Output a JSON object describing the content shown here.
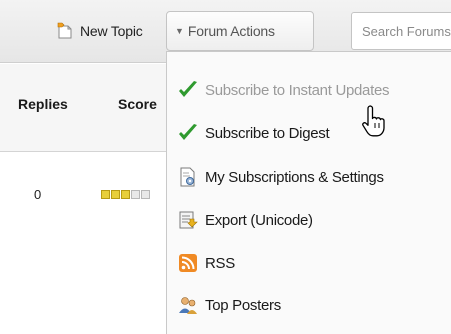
{
  "toolbar": {
    "new_topic_label": "New Topic",
    "forum_actions_label": "Forum Actions",
    "search_placeholder": "Search Forums"
  },
  "table": {
    "headers": {
      "replies": "Replies",
      "score": "Score"
    },
    "rows": [
      {
        "replies": "0",
        "score_filled": 3,
        "score_max": 5
      }
    ]
  },
  "menu": {
    "items": [
      {
        "label": "Subscribe to Instant Updates",
        "icon": "checkmark-icon",
        "state": "hover"
      },
      {
        "label": "Subscribe to Digest",
        "icon": "checkmark-icon"
      },
      {
        "label": "My Subscriptions & Settings",
        "icon": "settings-document-icon"
      },
      {
        "label": "Export (Unicode)",
        "icon": "export-icon"
      },
      {
        "label": "RSS",
        "icon": "rss-icon"
      },
      {
        "label": "Top Posters",
        "icon": "people-icon"
      }
    ]
  },
  "colors": {
    "check_green": "#2f9a2f",
    "rss_orange": "#f08a24",
    "score_on": "#e8cf3a"
  }
}
